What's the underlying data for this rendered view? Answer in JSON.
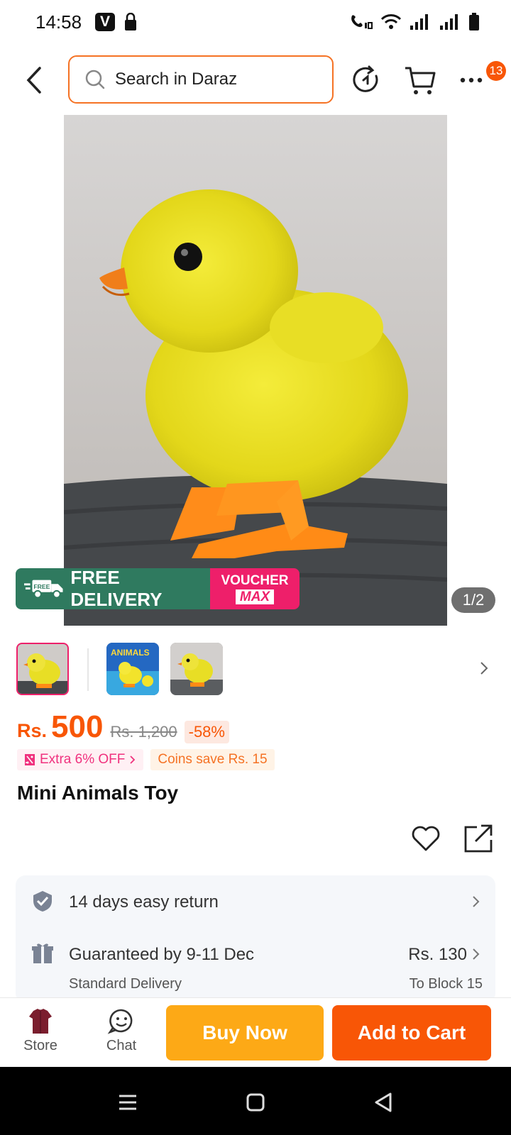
{
  "status_bar": {
    "time": "14:58",
    "v_badge": "V"
  },
  "search": {
    "placeholder": "Search in Daraz"
  },
  "nav": {
    "badge_count": "13"
  },
  "image": {
    "counter": "1/2",
    "promo_free_small": "FREE",
    "promo_free": "FREE DELIVERY",
    "promo_voucher_1": "VOUCHER",
    "promo_voucher_2": "MAX",
    "thumb_2_text": "ANIMALS"
  },
  "price": {
    "currency": "Rs.",
    "value": "500",
    "original": "Rs. 1,200",
    "discount": "-58%"
  },
  "tags": {
    "extra": "Extra 6% OFF",
    "coins": "Coins save Rs. 15"
  },
  "product": {
    "title": "Mini Animals Toy"
  },
  "info": {
    "return_text": "14 days easy return",
    "delivery_main": "Guaranteed by 9-11 Dec",
    "delivery_sub": "Standard Delivery",
    "delivery_price": "Rs. 130",
    "delivery_location": "To Block 15"
  },
  "actions": {
    "store": "Store",
    "chat": "Chat",
    "buy_now": "Buy Now",
    "add_to_cart": "Add to Cart"
  },
  "colors": {
    "brand_orange": "#f85606",
    "buy_now": "#fda916",
    "promo_green": "#2f7a5f",
    "promo_pink": "#ee1f6a"
  }
}
